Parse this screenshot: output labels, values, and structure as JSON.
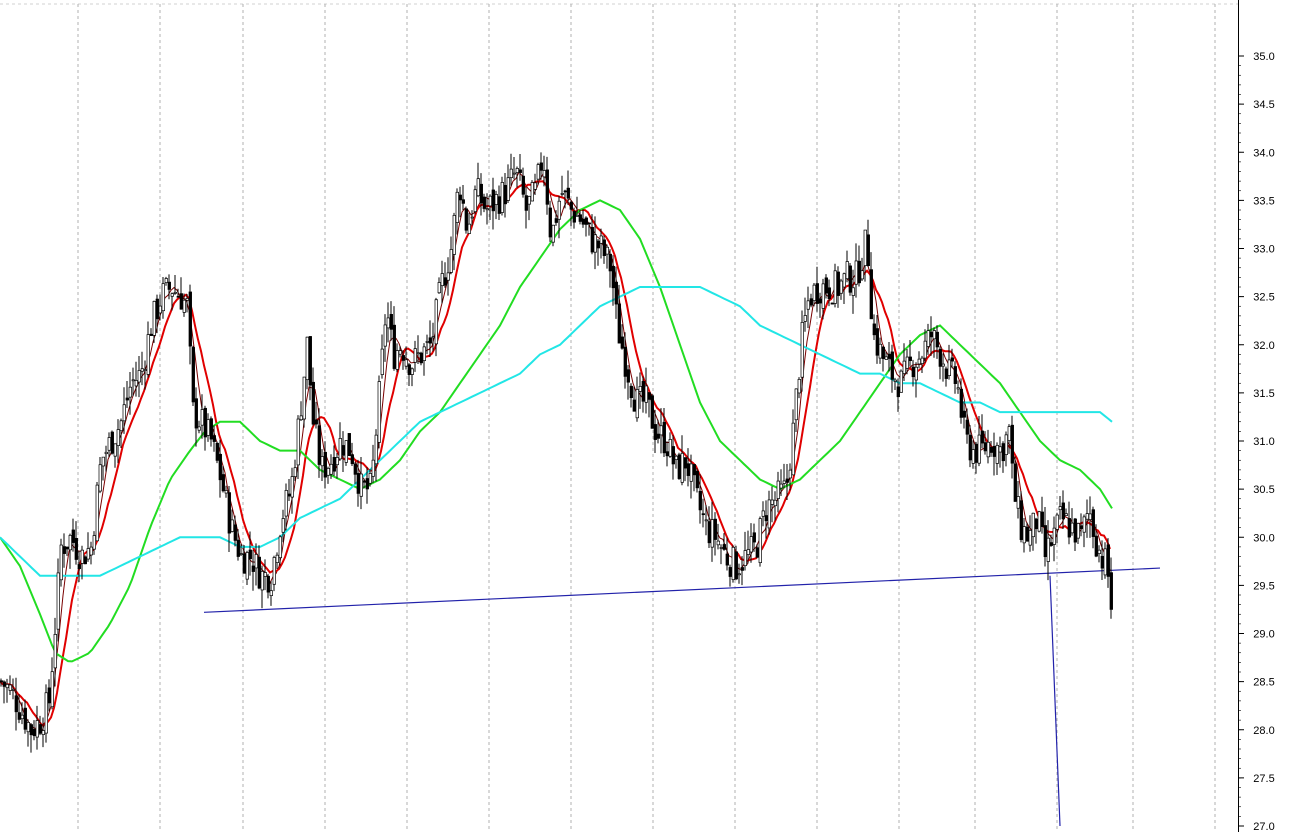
{
  "chart_data": {
    "type": "candlestick",
    "yaxis": {
      "min": 27.0,
      "max": 35.0,
      "ticks": [
        "35.0",
        "34.5",
        "34.0",
        "33.5",
        "33.0",
        "32.5",
        "32.0",
        "31.5",
        "31.0",
        "30.5",
        "30.0",
        "29.5",
        "29.0",
        "28.5",
        "28.0",
        "27.5",
        "27.0"
      ]
    },
    "colors": {
      "candle": "#000000",
      "ma_short": "#7a0000",
      "ma_medium": "#e00000",
      "ma_green": "#22dd22",
      "ma_cyan": "#22e6e6",
      "trendline": "#2222aa",
      "grid": "#b0b0b0",
      "background": "#ffffff"
    },
    "close_anchors": [
      [
        0,
        28.5
      ],
      [
        10,
        28.4
      ],
      [
        20,
        28.2
      ],
      [
        30,
        28.0
      ],
      [
        40,
        28.1
      ],
      [
        48,
        28.3
      ],
      [
        55,
        29.2
      ],
      [
        60,
        29.9
      ],
      [
        70,
        30.0
      ],
      [
        80,
        29.8
      ],
      [
        90,
        29.9
      ],
      [
        100,
        30.8
      ],
      [
        110,
        31.0
      ],
      [
        120,
        31.2
      ],
      [
        130,
        31.6
      ],
      [
        140,
        31.7
      ],
      [
        150,
        32.2
      ],
      [
        160,
        32.5
      ],
      [
        170,
        32.6
      ],
      [
        180,
        32.5
      ],
      [
        186,
        32.4
      ],
      [
        192,
        31.3
      ],
      [
        200,
        31.2
      ],
      [
        210,
        31.0
      ],
      [
        220,
        30.6
      ],
      [
        230,
        30.1
      ],
      [
        240,
        29.8
      ],
      [
        250,
        29.8
      ],
      [
        260,
        29.6
      ],
      [
        270,
        29.6
      ],
      [
        280,
        30.2
      ],
      [
        290,
        30.5
      ],
      [
        300,
        31.4
      ],
      [
        306,
        32.0
      ],
      [
        312,
        31.2
      ],
      [
        320,
        30.7
      ],
      [
        330,
        30.8
      ],
      [
        340,
        31.0
      ],
      [
        350,
        30.9
      ],
      [
        360,
        30.5
      ],
      [
        370,
        30.5
      ],
      [
        380,
        31.7
      ],
      [
        385,
        32.4
      ],
      [
        392,
        31.9
      ],
      [
        400,
        32.0
      ],
      [
        410,
        31.8
      ],
      [
        420,
        31.9
      ],
      [
        430,
        32.0
      ],
      [
        440,
        32.6
      ],
      [
        450,
        33.0
      ],
      [
        458,
        33.7
      ],
      [
        466,
        33.2
      ],
      [
        475,
        33.6
      ],
      [
        485,
        33.4
      ],
      [
        495,
        33.5
      ],
      [
        505,
        33.6
      ],
      [
        515,
        33.8
      ],
      [
        525,
        33.4
      ],
      [
        535,
        33.6
      ],
      [
        542,
        34.0
      ],
      [
        550,
        33.1
      ],
      [
        560,
        33.6
      ],
      [
        570,
        33.4
      ],
      [
        580,
        33.3
      ],
      [
        590,
        33.1
      ],
      [
        600,
        33.0
      ],
      [
        610,
        32.8
      ],
      [
        616,
        32.2
      ],
      [
        625,
        31.8
      ],
      [
        635,
        31.4
      ],
      [
        645,
        31.4
      ],
      [
        655,
        31.1
      ],
      [
        665,
        31.0
      ],
      [
        675,
        30.7
      ],
      [
        685,
        30.8
      ],
      [
        695,
        30.4
      ],
      [
        705,
        30.1
      ],
      [
        715,
        30.0
      ],
      [
        725,
        29.8
      ],
      [
        735,
        29.7
      ],
      [
        745,
        29.8
      ],
      [
        755,
        29.9
      ],
      [
        765,
        30.3
      ],
      [
        775,
        30.4
      ],
      [
        785,
        30.5
      ],
      [
        792,
        31.1
      ],
      [
        800,
        32.0
      ],
      [
        808,
        32.5
      ],
      [
        818,
        32.6
      ],
      [
        828,
        32.6
      ],
      [
        838,
        32.6
      ],
      [
        846,
        32.7
      ],
      [
        855,
        32.7
      ],
      [
        866,
        33.1
      ],
      [
        872,
        32.1
      ],
      [
        880,
        31.9
      ],
      [
        890,
        31.7
      ],
      [
        900,
        31.6
      ],
      [
        910,
        31.8
      ],
      [
        920,
        31.9
      ],
      [
        930,
        32.1
      ],
      [
        940,
        31.9
      ],
      [
        948,
        31.7
      ],
      [
        956,
        31.6
      ],
      [
        964,
        31.0
      ],
      [
        972,
        30.9
      ],
      [
        980,
        30.9
      ],
      [
        990,
        31.0
      ],
      [
        1000,
        30.9
      ],
      [
        1008,
        31.1
      ],
      [
        1012,
        30.5
      ],
      [
        1020,
        30.1
      ],
      [
        1028,
        30.0
      ],
      [
        1036,
        30.2
      ],
      [
        1044,
        29.8
      ],
      [
        1052,
        30.0
      ],
      [
        1060,
        30.2
      ],
      [
        1070,
        30.1
      ],
      [
        1080,
        30.0
      ],
      [
        1088,
        30.3
      ],
      [
        1094,
        30.0
      ],
      [
        1100,
        29.8
      ],
      [
        1106,
        29.7
      ],
      [
        1112,
        29.1
      ]
    ],
    "series": [
      {
        "type": "ma_short",
        "period": 5
      },
      {
        "type": "ma_medium",
        "period": 10
      },
      {
        "type": "ma_green",
        "anchors": [
          [
            0,
            30.0
          ],
          [
            20,
            29.7
          ],
          [
            40,
            29.2
          ],
          [
            55,
            28.8
          ],
          [
            70,
            28.7
          ],
          [
            90,
            28.8
          ],
          [
            110,
            29.1
          ],
          [
            130,
            29.5
          ],
          [
            150,
            30.1
          ],
          [
            170,
            30.6
          ],
          [
            190,
            30.9
          ],
          [
            205,
            31.1
          ],
          [
            220,
            31.2
          ],
          [
            240,
            31.2
          ],
          [
            260,
            31.0
          ],
          [
            280,
            30.9
          ],
          [
            300,
            30.9
          ],
          [
            320,
            30.7
          ],
          [
            340,
            30.6
          ],
          [
            360,
            30.5
          ],
          [
            380,
            30.6
          ],
          [
            400,
            30.8
          ],
          [
            420,
            31.1
          ],
          [
            440,
            31.3
          ],
          [
            460,
            31.6
          ],
          [
            480,
            31.9
          ],
          [
            500,
            32.2
          ],
          [
            520,
            32.6
          ],
          [
            540,
            32.9
          ],
          [
            560,
            33.2
          ],
          [
            580,
            33.4
          ],
          [
            600,
            33.5
          ],
          [
            620,
            33.4
          ],
          [
            640,
            33.1
          ],
          [
            660,
            32.6
          ],
          [
            680,
            32.0
          ],
          [
            700,
            31.4
          ],
          [
            720,
            31.0
          ],
          [
            740,
            30.8
          ],
          [
            760,
            30.6
          ],
          [
            780,
            30.5
          ],
          [
            800,
            30.6
          ],
          [
            820,
            30.8
          ],
          [
            840,
            31.0
          ],
          [
            860,
            31.3
          ],
          [
            880,
            31.6
          ],
          [
            900,
            31.9
          ],
          [
            920,
            32.1
          ],
          [
            940,
            32.2
          ],
          [
            960,
            32.0
          ],
          [
            980,
            31.8
          ],
          [
            1000,
            31.6
          ],
          [
            1020,
            31.3
          ],
          [
            1040,
            31.0
          ],
          [
            1060,
            30.8
          ],
          [
            1080,
            30.7
          ],
          [
            1100,
            30.5
          ],
          [
            1112,
            30.3
          ]
        ]
      },
      {
        "type": "ma_cyan",
        "anchors": [
          [
            0,
            30.0
          ],
          [
            20,
            29.8
          ],
          [
            40,
            29.6
          ],
          [
            60,
            29.6
          ],
          [
            80,
            29.6
          ],
          [
            100,
            29.6
          ],
          [
            120,
            29.7
          ],
          [
            140,
            29.8
          ],
          [
            160,
            29.9
          ],
          [
            180,
            30.0
          ],
          [
            200,
            30.0
          ],
          [
            220,
            30.0
          ],
          [
            240,
            29.9
          ],
          [
            260,
            29.9
          ],
          [
            280,
            30.0
          ],
          [
            300,
            30.2
          ],
          [
            320,
            30.3
          ],
          [
            340,
            30.4
          ],
          [
            360,
            30.6
          ],
          [
            380,
            30.8
          ],
          [
            400,
            31.0
          ],
          [
            420,
            31.2
          ],
          [
            440,
            31.3
          ],
          [
            460,
            31.4
          ],
          [
            480,
            31.5
          ],
          [
            500,
            31.6
          ],
          [
            520,
            31.7
          ],
          [
            540,
            31.9
          ],
          [
            560,
            32.0
          ],
          [
            580,
            32.2
          ],
          [
            600,
            32.4
          ],
          [
            620,
            32.5
          ],
          [
            640,
            32.6
          ],
          [
            660,
            32.6
          ],
          [
            680,
            32.6
          ],
          [
            700,
            32.6
          ],
          [
            720,
            32.5
          ],
          [
            740,
            32.4
          ],
          [
            760,
            32.2
          ],
          [
            780,
            32.1
          ],
          [
            800,
            32.0
          ],
          [
            820,
            31.9
          ],
          [
            840,
            31.8
          ],
          [
            860,
            31.7
          ],
          [
            880,
            31.7
          ],
          [
            900,
            31.6
          ],
          [
            920,
            31.6
          ],
          [
            940,
            31.5
          ],
          [
            960,
            31.4
          ],
          [
            980,
            31.4
          ],
          [
            1000,
            31.3
          ],
          [
            1020,
            31.3
          ],
          [
            1040,
            31.3
          ],
          [
            1060,
            31.3
          ],
          [
            1080,
            31.3
          ],
          [
            1100,
            31.3
          ],
          [
            1112,
            31.2
          ]
        ]
      }
    ],
    "neckline": {
      "start": [
        204,
        29.22
      ],
      "end": [
        1160,
        29.68
      ]
    },
    "target_line": {
      "start": [
        1050,
        29.6
      ],
      "end": [
        1060,
        27.0
      ]
    },
    "xlabel": "",
    "ylabel": ""
  }
}
